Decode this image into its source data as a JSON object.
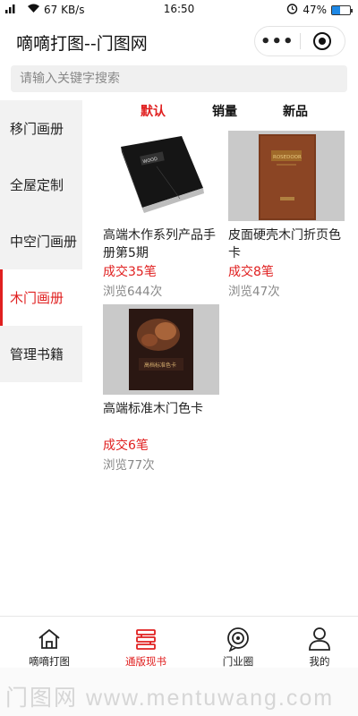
{
  "status_bar": {
    "signal": "•ıl",
    "net_speed": "67 KB/s",
    "time": "16:50",
    "battery": "47%",
    "battery_level": 0.47
  },
  "header": {
    "title": "嘀嘀打图--门图网",
    "more": "•••"
  },
  "search": {
    "placeholder": "请输入关键字搜索"
  },
  "sidebar": {
    "items": [
      {
        "label": "移门画册",
        "active": false
      },
      {
        "label": "全屋定制",
        "active": false
      },
      {
        "label": "中空门画册",
        "active": false
      },
      {
        "label": "木门画册",
        "active": true
      },
      {
        "label": "管理书籍",
        "active": false
      }
    ]
  },
  "sort_tabs": [
    {
      "label": "默认",
      "active": true
    },
    {
      "label": "销量",
      "active": false
    },
    {
      "label": "新品",
      "active": false
    }
  ],
  "products": [
    {
      "name": "高端木作系列产品手册第5期",
      "sold": "成交35笔",
      "views": "浏览644次",
      "cover_text": "WOOD"
    },
    {
      "name": "皮面硬壳木门折页色卡",
      "sold": "成交8笔",
      "views": "浏览47次",
      "cover_text": "ROSEDOOR"
    },
    {
      "name": "高端标准木门色卡",
      "sold": "成交6笔",
      "views": "浏览77次",
      "cover_text": "高档标准色卡"
    }
  ],
  "bottom_nav": [
    {
      "label": "嘀嘀打图",
      "icon": "home-icon",
      "active": false
    },
    {
      "label": "通版现书",
      "icon": "book-stack-icon",
      "active": true
    },
    {
      "label": "门业圈",
      "icon": "circle-chat-icon",
      "active": false
    },
    {
      "label": "我的",
      "icon": "user-icon",
      "active": false
    }
  ],
  "watermark": {
    "text": "门图网 www.mentuwang.com"
  },
  "colors": {
    "accent": "#e02020",
    "sidebar_bg": "#f2f2f2",
    "muted_text": "#888888"
  }
}
